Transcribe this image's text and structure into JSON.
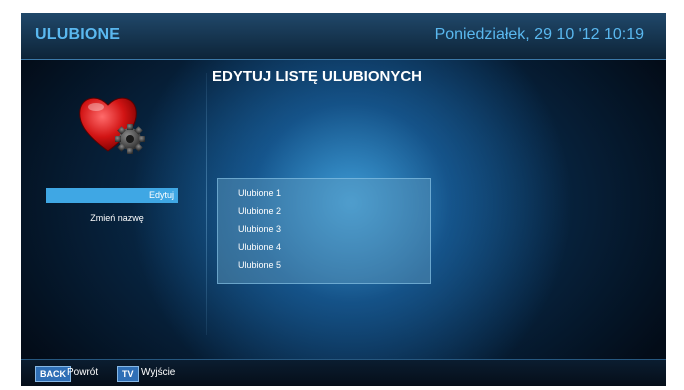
{
  "header": {
    "title": "ULUBIONE",
    "datetime": "Poniedziałek, 29 10 '12 10:19"
  },
  "main": {
    "heading": "EDYTUJ LISTĘ ULUBIONYCH",
    "icon": "heart-gear-icon"
  },
  "menu": {
    "items": [
      {
        "label": "Edytuj",
        "selected": true
      },
      {
        "label": "Zmień nazwę",
        "selected": false
      }
    ]
  },
  "favorites": {
    "items": [
      "Ulubione 1",
      "Ulubione 2",
      "Ulubione 3",
      "Ulubione 4",
      "Ulubione 5"
    ]
  },
  "footer": {
    "back_key": "BACK",
    "back_label": "Powrót",
    "tv_key": "TV",
    "tv_label": "Wyjście"
  },
  "colors": {
    "accent": "#5ab8ef",
    "selection": "#3fa7e4",
    "key": "#2f6fb6"
  }
}
